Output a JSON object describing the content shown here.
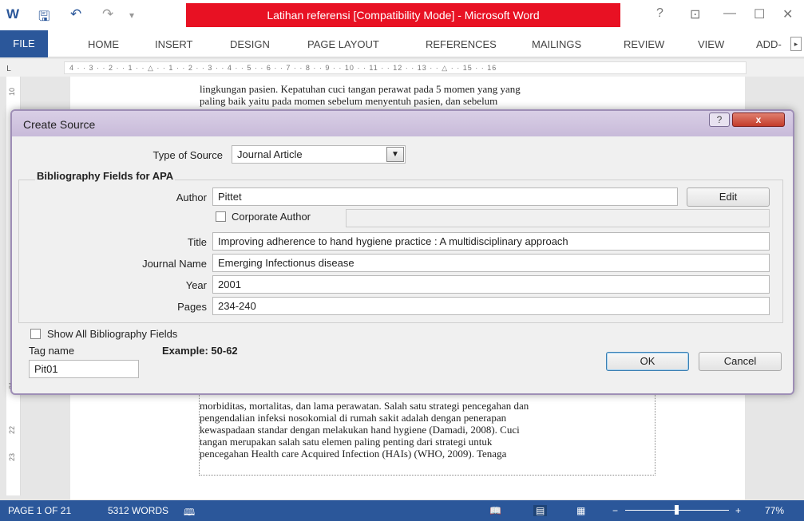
{
  "window": {
    "title": "Latihan referensi [Compatibility Mode] - Microsoft Word",
    "help": "?",
    "controls": [
      "⊡",
      "—",
      "☐",
      "✕"
    ]
  },
  "ribbon": {
    "tabs": [
      "FILE",
      "HOME",
      "INSERT",
      "DESIGN",
      "PAGE LAYOUT",
      "REFERENCES",
      "MAILINGS",
      "REVIEW",
      "VIEW",
      "ADD-"
    ]
  },
  "ruler": {
    "text": "4 · · 3 · · 2 · · 1 · · △ · · 1 · · 2 · · 3 · · 4 · · 5 · · 6 · · 7 · · 8 · · 9 · · 10 · · 11 · · 12 · · 13 · · △ · · 15 · · 16",
    "vnums": [
      "10",
      "21",
      "22",
      "23"
    ]
  },
  "document": {
    "top_lines": [
      "lingkungan pasien. Kepatuhan cuci tangan perawat pada 5 momen yang yang",
      "paling baik yaitu pada momen sebelum menyentuh pasien, dan sebelum"
    ],
    "bottom_lines": [
      "morbiditas, mortalitas, dan lama perawatan. Salah satu strategi pencegahan dan",
      "pengendalian infeksi nosokomial di rumah sakit adalah dengan penerapan",
      "kewaspadaan standar dengan melakukan hand hygiene (Damadi, 2008). Cuci",
      "tangan merupakan salah satu elemen paling penting dari strategi untuk",
      "pencegahan Health care Acquired Infection (HAIs) (WHO, 2009). Tenaga"
    ]
  },
  "dialog": {
    "title": "Create Source",
    "help_button": "?",
    "close_button": "x",
    "type_of_source_label": "Type of Source",
    "type_of_source_value": "Journal Article",
    "group_label": "Bibliography Fields for APA",
    "author_label": "Author",
    "author_value": "Pittet",
    "edit_button": "Edit",
    "corporate_author_label": "Corporate Author",
    "title_label": "Title",
    "title_value": "Improving adherence to hand hygiene practice : A multidisciplinary approach",
    "journal_label": "Journal Name",
    "journal_value": "Emerging Infectionus disease",
    "year_label": "Year",
    "year_value": "2001",
    "pages_label": "Pages",
    "pages_value": "234-240",
    "show_all_label": "Show All Bibliography Fields",
    "tag_label": "Tag name",
    "example_label": "Example: 50-62",
    "tag_value": "Pit01",
    "ok_button": "OK",
    "cancel_button": "Cancel"
  },
  "status": {
    "page": "PAGE 1 OF 21",
    "words": "5312 WORDS",
    "zoom": "77%"
  },
  "colors": {
    "accent": "#2b579a",
    "title_highlight": "#e81123"
  }
}
